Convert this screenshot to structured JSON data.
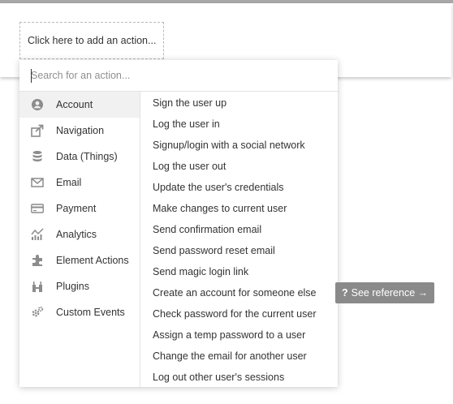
{
  "workflow": {
    "add_action_label": "Click here to add an action..."
  },
  "search": {
    "placeholder": "Search for an action..."
  },
  "categories": [
    {
      "label": "Account",
      "icon": "account-icon",
      "active": true
    },
    {
      "label": "Navigation",
      "icon": "navigation-icon"
    },
    {
      "label": "Data (Things)",
      "icon": "database-icon"
    },
    {
      "label": "Email",
      "icon": "email-icon"
    },
    {
      "label": "Payment",
      "icon": "payment-icon"
    },
    {
      "label": "Analytics",
      "icon": "analytics-icon"
    },
    {
      "label": "Element Actions",
      "icon": "element-actions-icon"
    },
    {
      "label": "Plugins",
      "icon": "plugins-icon"
    },
    {
      "label": "Custom Events",
      "icon": "custom-events-icon"
    }
  ],
  "actions": [
    "Sign the user up",
    "Log the user in",
    "Signup/login with a social network",
    "Log the user out",
    "Update the user's credentials",
    "Make changes to current user",
    "Send confirmation email",
    "Send password reset email",
    "Send magic login link",
    "Create an account for someone else",
    "Check password for the current user",
    "Assign a temp password to a user",
    "Change the email for another user",
    "Log out other user's sessions"
  ],
  "reference": {
    "mark": "?",
    "label": "See reference →"
  },
  "colors": {
    "active_category_bg": "#f1f1f1",
    "reference_bg": "#8a8a8a",
    "icon_gray": "#8c8c8c"
  }
}
